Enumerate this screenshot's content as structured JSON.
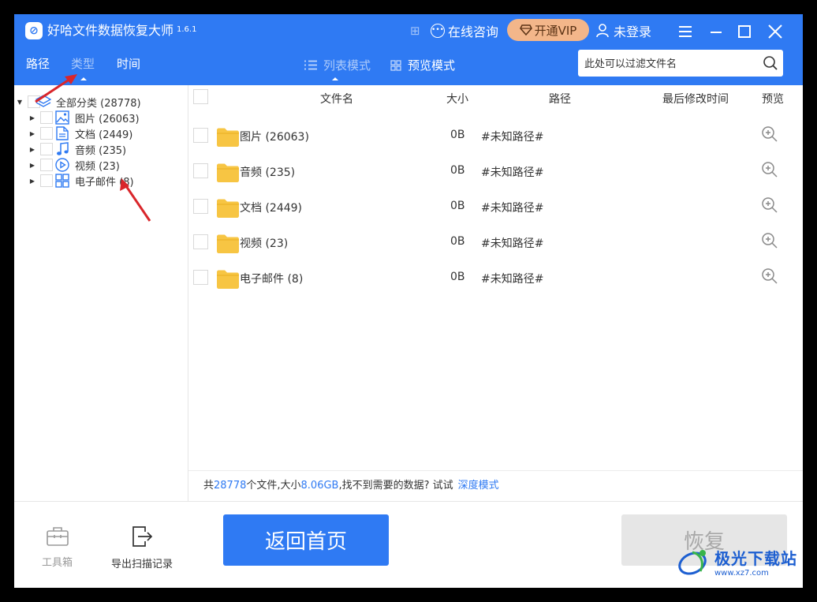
{
  "app": {
    "title": "好哈文件数据恢复大师",
    "version": "1.6.1"
  },
  "header": {
    "consult_label": "在线咨询",
    "vip_label": "开通VIP",
    "login_label": "未登录",
    "tabs": [
      {
        "label": "路径",
        "active": false
      },
      {
        "label": "类型",
        "active": true
      },
      {
        "label": "时间",
        "active": false
      }
    ],
    "view_modes": [
      {
        "label": "列表模式",
        "active": true
      },
      {
        "label": "预览模式",
        "active": false
      }
    ],
    "search_placeholder": "此处可以过滤文件名"
  },
  "tree": {
    "root": {
      "label": "全部分类 (28778)",
      "icon": "layers-icon"
    },
    "children": [
      {
        "label": "图片 (26063)",
        "icon": "image-icon"
      },
      {
        "label": "文档 (2449)",
        "icon": "document-icon"
      },
      {
        "label": "音频 (235)",
        "icon": "music-icon"
      },
      {
        "label": "视频 (23)",
        "icon": "video-icon"
      },
      {
        "label": "电子邮件 (8)",
        "icon": "grid-icon"
      }
    ]
  },
  "table": {
    "headers": {
      "name": "文件名",
      "size": "大小",
      "path": "路径",
      "modified": "最后修改时间",
      "preview": "预览"
    },
    "rows": [
      {
        "name": "图片 (26063)",
        "size": "0B",
        "path": "#未知路径#"
      },
      {
        "name": "音频 (235)",
        "size": "0B",
        "path": "#未知路径#"
      },
      {
        "name": "文档 (2449)",
        "size": "0B",
        "path": "#未知路径#"
      },
      {
        "name": "视频 (23)",
        "size": "0B",
        "path": "#未知路径#"
      },
      {
        "name": "电子邮件 (8)",
        "size": "0B",
        "path": "#未知路径#"
      }
    ]
  },
  "status": {
    "prefix": "共",
    "file_count": "28778",
    "mid": "个文件,大小",
    "total_size": "8.06GB",
    "suffix": ",找不到需要的数据? 试试",
    "deep_mode_link": "深度模式"
  },
  "footer": {
    "toolbox_label": "工具箱",
    "export_label": "导出扫描记录",
    "home_button": "返回首页",
    "recover_button": "恢复"
  },
  "watermark": {
    "text": "极光下载站",
    "url": "www.xz7.com"
  },
  "colors": {
    "primary": "#2f7af3",
    "vip_bg": "#f3b68a",
    "folder": "#f7c543",
    "annotation_arrow": "#d9262b"
  }
}
